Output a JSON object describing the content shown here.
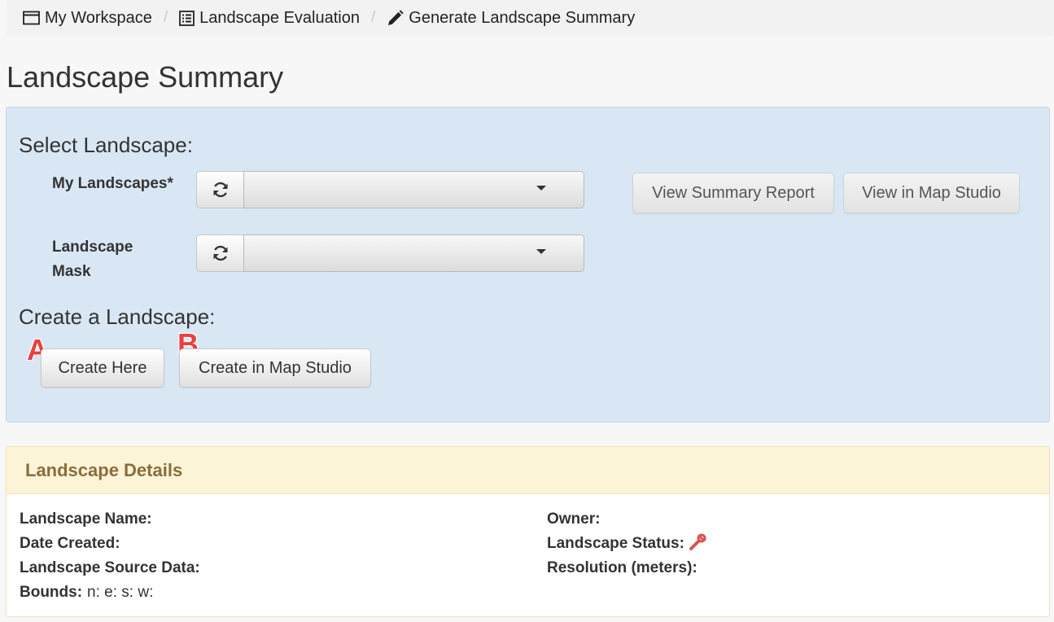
{
  "breadcrumb": {
    "items": [
      {
        "label": "My Workspace",
        "icon": "window-icon"
      },
      {
        "label": "Landscape Evaluation",
        "icon": "list-icon"
      },
      {
        "label": "Generate Landscape Summary",
        "icon": "pencil-icon"
      }
    ],
    "separator": "/"
  },
  "page_title": "Landscape Summary",
  "select_section": {
    "heading": "Select Landscape:",
    "my_landscapes_label": "My Landscapes*",
    "my_landscapes_value": "",
    "mask_label": "Landscape Mask",
    "mask_value": "",
    "view_summary_label": "View Summary Report",
    "view_map_studio_label": "View in Map Studio"
  },
  "create_section": {
    "heading": "Create a Landscape:",
    "create_here_label": "Create Here",
    "create_map_studio_label": "Create in Map Studio",
    "annotation_a": "A",
    "annotation_b": "B"
  },
  "details": {
    "title": "Landscape Details",
    "name_label": "Landscape Name:",
    "date_label": "Date Created:",
    "source_label": "Landscape Source Data:",
    "bounds_label": "Bounds:",
    "bounds_value": "n: e: s: w:",
    "owner_label": "Owner:",
    "status_label": "Landscape Status:",
    "resolution_label": "Resolution (meters):"
  },
  "colors": {
    "panel_blue": "#d9e7f5",
    "details_header": "#fcf4d7",
    "details_title": "#8a6d3b",
    "annotation": "#e94040",
    "wrench": "#d9534f"
  }
}
